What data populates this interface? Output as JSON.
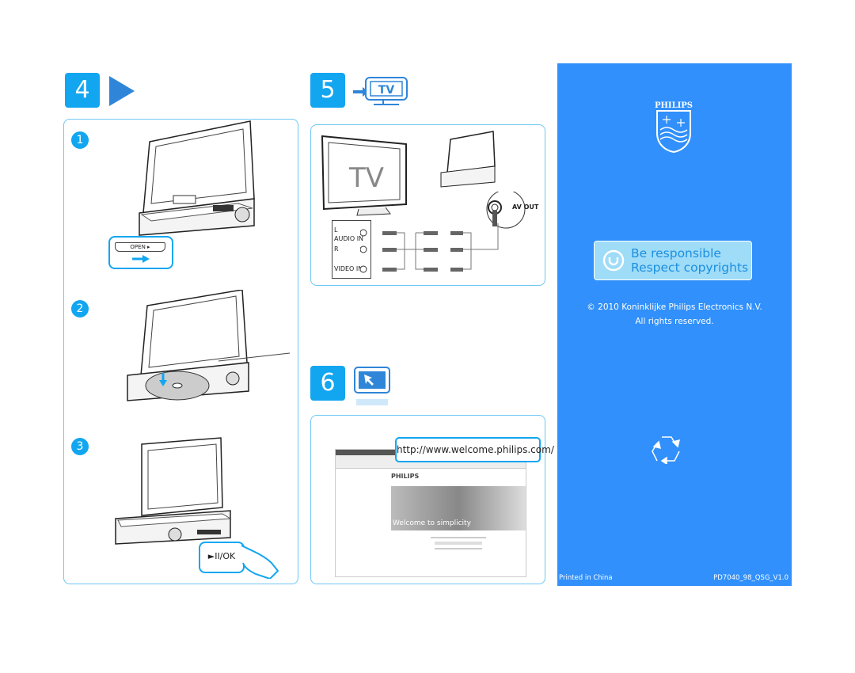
{
  "steps": {
    "step4": {
      "number": "4",
      "icon": "play-icon"
    },
    "step5": {
      "number": "5",
      "icon": "tv-icon",
      "icon_label": "TV"
    },
    "step6": {
      "number": "6",
      "icon": "monitor-cursor-icon"
    }
  },
  "step4_panel": {
    "substeps": [
      "1",
      "2",
      "3"
    ],
    "open_button_label": "OPEN ▸",
    "play_ok_label": "►II/OK"
  },
  "step5_panel": {
    "tv_label": "TV",
    "av_out_label": "AV OUT",
    "jack_labels": {
      "left": "L",
      "audio_in": "AUDIO IN",
      "right": "R",
      "video_in": "VIDEO IN"
    }
  },
  "step6_panel": {
    "url": "http://www.welcome.philips.com/",
    "browser_brand": "PHILIPS",
    "banner_text": "Welcome to simplicity"
  },
  "back_panel": {
    "brand": "PHILIPS",
    "responsible_line1": "Be responsible",
    "responsible_line2": "Respect copyrights",
    "copyright": "© 2010 Koninklijke Philips Electronics N.V.",
    "rights": "All rights reserved.",
    "printed": "Printed in China",
    "code": "PD7040_98_QSG_V1.0",
    "colors": {
      "panel": "#3190fb",
      "accent": "#12a6f0"
    }
  }
}
